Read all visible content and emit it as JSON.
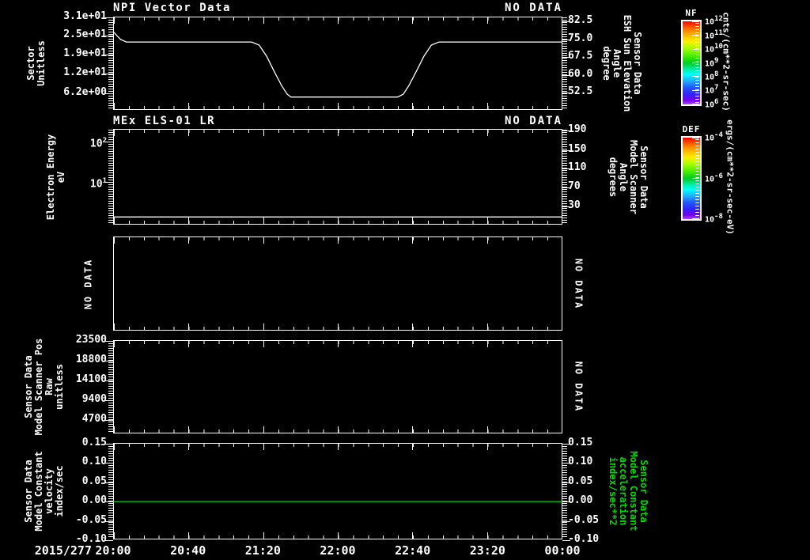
{
  "date_label": "2015/277",
  "x_ticks": [
    "20:00",
    "20:40",
    "21:20",
    "22:00",
    "22:40",
    "23:20",
    "00:00"
  ],
  "colors": {
    "background": "#000000",
    "foreground": "#ffffff",
    "accent_green": "#00dd00"
  },
  "panels": [
    {
      "id": "p1",
      "title": "NPI Vector Data",
      "status": "NO DATA",
      "left_axis": {
        "label_lines": [
          "Sector",
          "Unitless"
        ],
        "ticks": [
          {
            "label": "3.1e+01",
            "frac": 0.0
          },
          {
            "label": "2.5e+01",
            "frac": 0.195
          },
          {
            "label": "1.9e+01",
            "frac": 0.4
          },
          {
            "label": "1.2e+01",
            "frac": 0.6
          },
          {
            "label": "6.2e+00",
            "frac": 0.815
          }
        ]
      },
      "right_axis": {
        "label_lines": [
          "Sensor Data",
          "ESH Sun Elevation",
          "Angle",
          "degree"
        ],
        "ticks": [
          {
            "label": "82.5",
            "frac": 0.042
          },
          {
            "label": "75.0",
            "frac": 0.234
          },
          {
            "label": "67.5",
            "frac": 0.425
          },
          {
            "label": "60.0",
            "frac": 0.617
          },
          {
            "label": "52.5",
            "frac": 0.808
          }
        ]
      }
    },
    {
      "id": "p2",
      "title": "MEx ELS-01 LR",
      "status": "NO DATA",
      "left_axis": {
        "label_lines": [
          "Electron Energy",
          "eV"
        ],
        "ticks": [
          {
            "label": "10^2",
            "frac": 0.124
          },
          {
            "label": "10^1",
            "frac": 0.545
          }
        ]
      },
      "right_axis": {
        "label_lines": [
          "Sensor Data",
          "Model Scanner",
          "Angle",
          "degrees"
        ],
        "ticks": [
          {
            "label": "190",
            "frac": 0.01
          },
          {
            "label": "150",
            "frac": 0.215
          },
          {
            "label": "110",
            "frac": 0.405
          },
          {
            "label": "70",
            "frac": 0.6
          },
          {
            "label": "30",
            "frac": 0.8
          }
        ]
      }
    },
    {
      "id": "p3",
      "left_no_data": "NO DATA",
      "right_no_data": "NO DATA"
    },
    {
      "id": "p4",
      "left_axis": {
        "label_lines": [
          "Sensor Data",
          "Model Scanner Pos",
          "Raw",
          "unitless"
        ],
        "ticks": [
          {
            "label": "23500",
            "frac": 0.0
          },
          {
            "label": "18800",
            "frac": 0.212
          },
          {
            "label": "14100",
            "frac": 0.424
          },
          {
            "label": "9400",
            "frac": 0.636
          },
          {
            "label": "4700",
            "frac": 0.848
          }
        ]
      },
      "right_no_data": "NO DATA"
    },
    {
      "id": "p5",
      "left_axis": {
        "label_lines": [
          "Sensor Data",
          "Model Constant",
          "velocity",
          "index/sec"
        ],
        "ticks": [
          {
            "label": "0.15",
            "frac": 0.0
          },
          {
            "label": "0.10",
            "frac": 0.2
          },
          {
            "label": "0.05",
            "frac": 0.4
          },
          {
            "label": "0.00",
            "frac": 0.6
          },
          {
            "label": "-0.05",
            "frac": 0.8
          },
          {
            "label": "-0.10",
            "frac": 1.0
          }
        ]
      },
      "right_axis": {
        "label_lines": [
          "Sensor Data",
          "Model Constant",
          "acceleration",
          "index/sec**2"
        ],
        "color": "#00dd00",
        "ticks": [
          {
            "label": "0.15",
            "frac": 0.0
          },
          {
            "label": "0.10",
            "frac": 0.2
          },
          {
            "label": "0.05",
            "frac": 0.4
          },
          {
            "label": "0.00",
            "frac": 0.6
          },
          {
            "label": "-0.05",
            "frac": 0.8
          },
          {
            "label": "-0.10",
            "frac": 1.0
          }
        ]
      }
    }
  ],
  "colorbars": [
    {
      "name": "NF",
      "units": "cnts/(cm**2-sr-sec)",
      "ticks": [
        {
          "label": "10^12",
          "frac": 0.0
        },
        {
          "label": "10^11",
          "frac": 0.167
        },
        {
          "label": "10^10",
          "frac": 0.333
        },
        {
          "label": "10^9",
          "frac": 0.5
        },
        {
          "label": "10^8",
          "frac": 0.667
        },
        {
          "label": "10^7",
          "frac": 0.833
        },
        {
          "label": "10^6",
          "frac": 1.0
        }
      ]
    },
    {
      "name": "DEF",
      "units": "ergs/(cm**2-sr-sec-eV)",
      "ticks": [
        {
          "label": "10^-4",
          "frac": 0.0
        },
        {
          "label": "10^-6",
          "frac": 0.5
        },
        {
          "label": "10^-8",
          "frac": 1.0
        }
      ]
    }
  ],
  "chart_data": [
    {
      "panel": "p1",
      "type": "line",
      "name": "ESH Sun Elevation Angle",
      "units": "degree",
      "color": "#ffffff",
      "x_unit": "minutes since 2015/277 20:00",
      "x_range": [
        "20:00",
        "00:00"
      ],
      "t_min": [
        0,
        2,
        4,
        7,
        74,
        78,
        82,
        86,
        90,
        93,
        95,
        152,
        155,
        158,
        162,
        166,
        170,
        174,
        240
      ],
      "deg": [
        77.9,
        76.2,
        74.6,
        73.5,
        73.5,
        72.2,
        67.5,
        61.2,
        55.2,
        51.6,
        50.4,
        50.4,
        51.6,
        55.2,
        61.2,
        67.5,
        72.2,
        73.5,
        73.5
      ]
    },
    {
      "panel": "p2",
      "type": "line",
      "name": "Electron Energy lowest sweep step",
      "units": "eV",
      "color": "#ffffff",
      "constant_value": 1.3,
      "y_frac": 0.92,
      "note": "flat trace across full time range near bottom of log panel"
    },
    {
      "panel": "p5",
      "type": "line",
      "name": "Model Constant velocity",
      "units": "index/sec",
      "color": "#00dd00",
      "constant_value": 0.0,
      "y_frac": 0.607,
      "ylim": [
        -0.1,
        0.15
      ],
      "note": "flat green trace at 0.00 across full time range"
    }
  ]
}
